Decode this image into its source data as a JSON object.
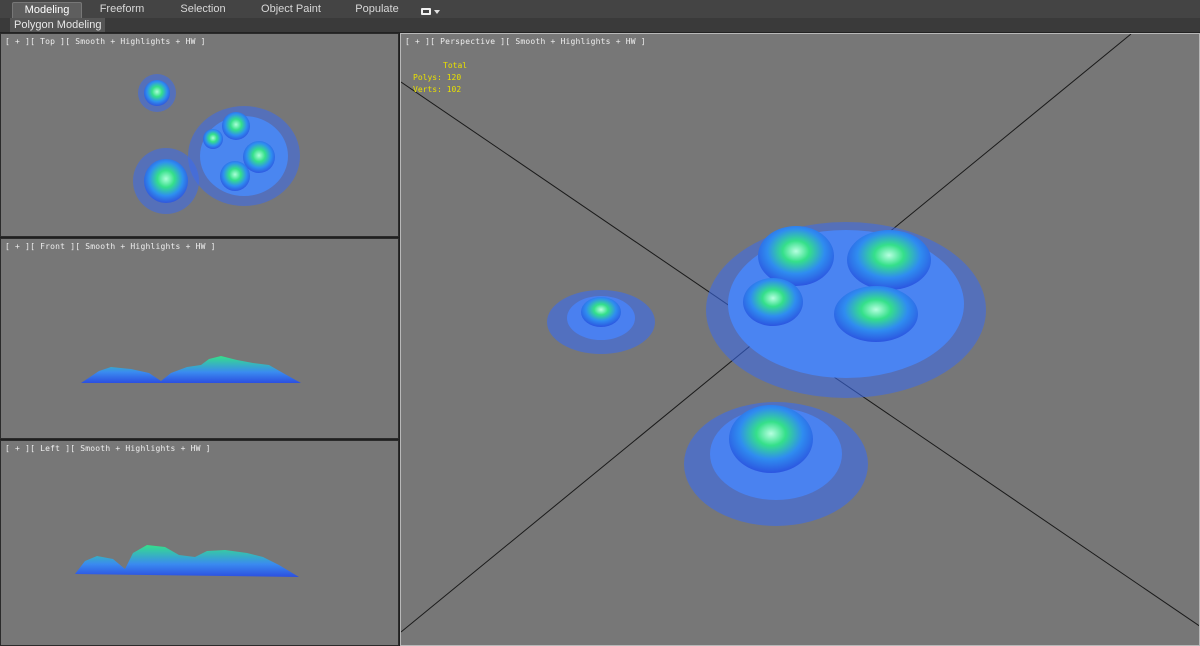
{
  "ribbon": {
    "tabs": [
      {
        "label": "Modeling",
        "active": true
      },
      {
        "label": "Freeform",
        "active": false
      },
      {
        "label": "Selection",
        "active": false
      },
      {
        "label": "Object Paint",
        "active": false
      },
      {
        "label": "Populate",
        "active": false
      }
    ],
    "dropdown_icon": "panel-toggle-dropdown-icon"
  },
  "subbar": {
    "panel_label": "Polygon Modeling"
  },
  "viewports": {
    "top": {
      "label": "[ + ][ Top ][ Smooth + Highlights + HW ]"
    },
    "front": {
      "label": "[ + ][ Front ][ Smooth + Highlights + HW ]"
    },
    "left": {
      "label": "[ + ][ Left ][ Smooth + Highlights + HW ]"
    },
    "perspective": {
      "label": "[ + ][ Perspective ][ Smooth + Highlights + HW ]",
      "stats": {
        "title": "Total",
        "polys_label": "Polys:",
        "polys_value": "120",
        "verts_label": "Verts:",
        "verts_value": "102"
      }
    }
  },
  "colors": {
    "viewport_bg": "#777777",
    "mesh_blue": "#3a6cf0",
    "mesh_green": "#35e08a",
    "stats_text": "#e8e000"
  }
}
